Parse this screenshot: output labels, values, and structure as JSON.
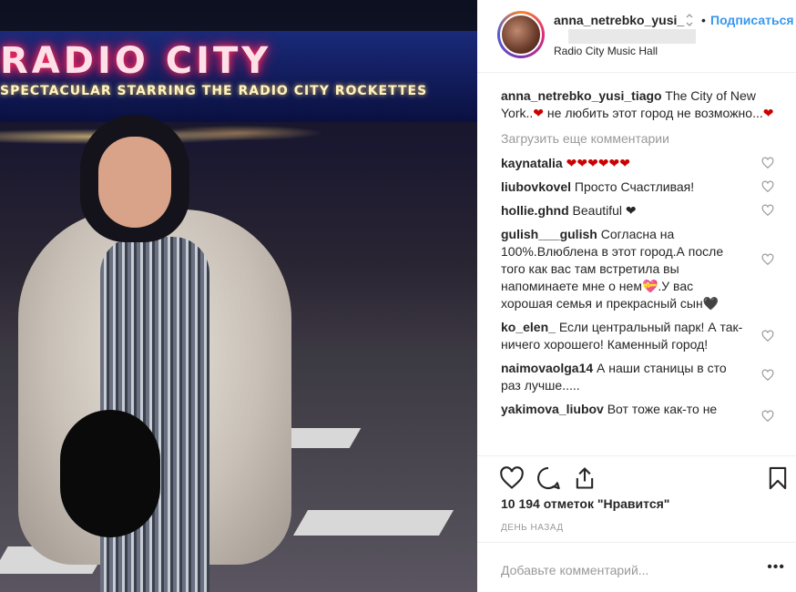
{
  "header": {
    "username": "anna_netrebko_yusi_",
    "separator": "•",
    "follow_label": "Подписаться",
    "location": "Radio City Music Hall"
  },
  "photo": {
    "sign_main": "RADIO CITY",
    "sign_sub": "SPECTACULAR STARRING THE RADIO CITY ROCKETTES"
  },
  "caption": {
    "username": "anna_netrebko_yusi_tiago",
    "text_1": "The City of New York..",
    "heart_1": "❤",
    "text_2": " не любить этот город не возможно...",
    "heart_2": "❤"
  },
  "load_more_label": "Загрузить еще комментарии",
  "comments": [
    {
      "user": "kaynatalia",
      "text": "❤❤❤❤❤❤"
    },
    {
      "user": "liubovkovel",
      "text": "Просто Счастливая!"
    },
    {
      "user": "hollie.ghnd",
      "text": "Beautiful ❤"
    },
    {
      "user": "gulish___gulish",
      "text": "Согласна на 100%.Влюблена в этот город.А после того как вас там встретила вы напоминаете мне о нем💝.У вас хорошая семья и прекрасный сын🖤"
    },
    {
      "user": "ko_elen_",
      "text": "Если центральный парк! А так- ничего хорошего! Каменный город!"
    },
    {
      "user": "naimovaolga14",
      "text": "А наши станицы в сто раз лучше....."
    },
    {
      "user": "yakimova_liubov",
      "text": "Вот тоже как-то не"
    }
  ],
  "likes_text": "10 194 отметок \"Нравится\"",
  "time_text": "ДЕНЬ НАЗАД",
  "add_comment_placeholder": "Добавьте комментарий...",
  "more_label": "•••",
  "icons": {
    "like": "heart-outline-icon",
    "comment": "speech-bubble-icon",
    "share": "share-icon",
    "save": "bookmark-icon"
  }
}
